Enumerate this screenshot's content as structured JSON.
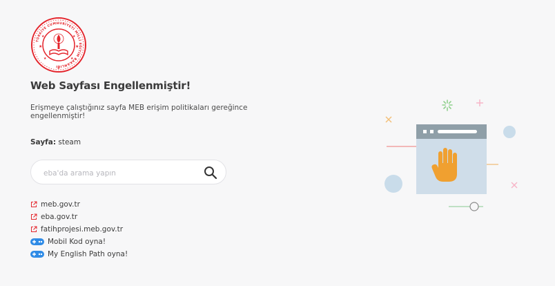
{
  "header": {
    "logo_name": "meb-logo",
    "logo_text": "TÜRKİYE CUMHURİYETİ MİLLÎ EĞİTİM BAKANLIĞI"
  },
  "main": {
    "title": "Web Sayfası Engellenmiştir!",
    "description": "Erişmeye çalıştığınız sayfa MEB erişim politikaları gereğince engellenmiştir!",
    "site_label": "Sayfa:",
    "site_value": "steam"
  },
  "search": {
    "placeholder": "eba'da arama yapın",
    "value": ""
  },
  "links": [
    {
      "label": "meb.gov.tr",
      "icon": "external-link-icon"
    },
    {
      "label": "eba.gov.tr",
      "icon": "external-link-icon"
    },
    {
      "label": "fatihprojesi.meb.gov.tr",
      "icon": "external-link-icon"
    },
    {
      "label": "Mobil Kod oyna!",
      "icon": "gamepad-icon"
    },
    {
      "label": "My English Path oyna!",
      "icon": "gamepad-icon"
    }
  ],
  "colors": {
    "brand_red": "#e4252c",
    "accent_blue": "#2f8be6",
    "hand_orange": "#f0a030",
    "window_gray": "#8f9fa8"
  }
}
